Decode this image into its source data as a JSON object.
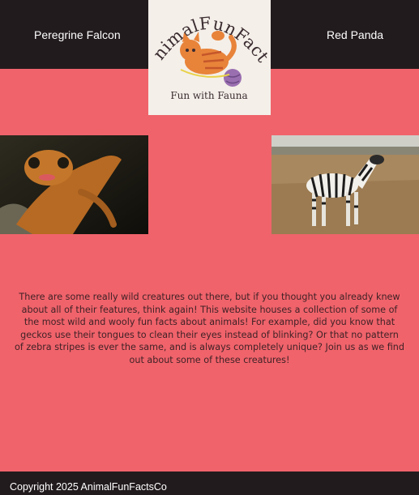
{
  "nav": {
    "left_link": "Peregrine Falcon",
    "right_link": "Red Panda"
  },
  "logo": {
    "title": "AnimalFunFacts",
    "tagline": "Fun with Fauna"
  },
  "images": {
    "left": "gecko photo",
    "right": "zebra photo"
  },
  "intro": {
    "text": "There are some really wild creatures out there, but if you thought you already knew about all of their features, think again! This website houses a collection of some of the most wild and wooly fun facts about animals! For example, did you know that geckos use their tongues to clean their eyes instead of blinking? Or that no pattern of zebra stripes is ever the same, and is always completely unique? Join us as we find out about some of these creatures!"
  },
  "footer": {
    "copyright": "Copyright 2025 AnimalFunFactsCo"
  },
  "colors": {
    "page_background": "#f0636b",
    "bar_background": "#221b1d",
    "logo_background": "#f4efe9",
    "body_text": "#3f2226"
  }
}
